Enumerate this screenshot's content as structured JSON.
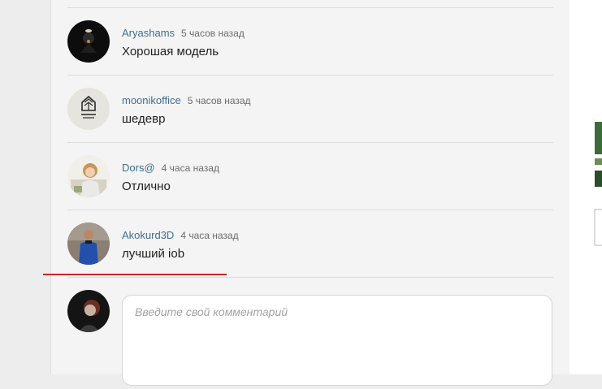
{
  "comments": [
    {
      "author": "Aryashams",
      "time": "5 часов назад",
      "text": "Хорошая модель"
    },
    {
      "author": "moonikoffice",
      "time": "5 часов назад",
      "text": "шедевр"
    },
    {
      "author": "Dors@",
      "time": "4 часа назад",
      "text": "Отлично"
    },
    {
      "author": "Akokurd3D",
      "time": "4 часа назад",
      "text": "лучший iob"
    }
  ],
  "comment_input": {
    "placeholder": "Введите свой комментарий"
  },
  "colors": {
    "accent": "#3f6f8d",
    "underline": "#c62828"
  }
}
